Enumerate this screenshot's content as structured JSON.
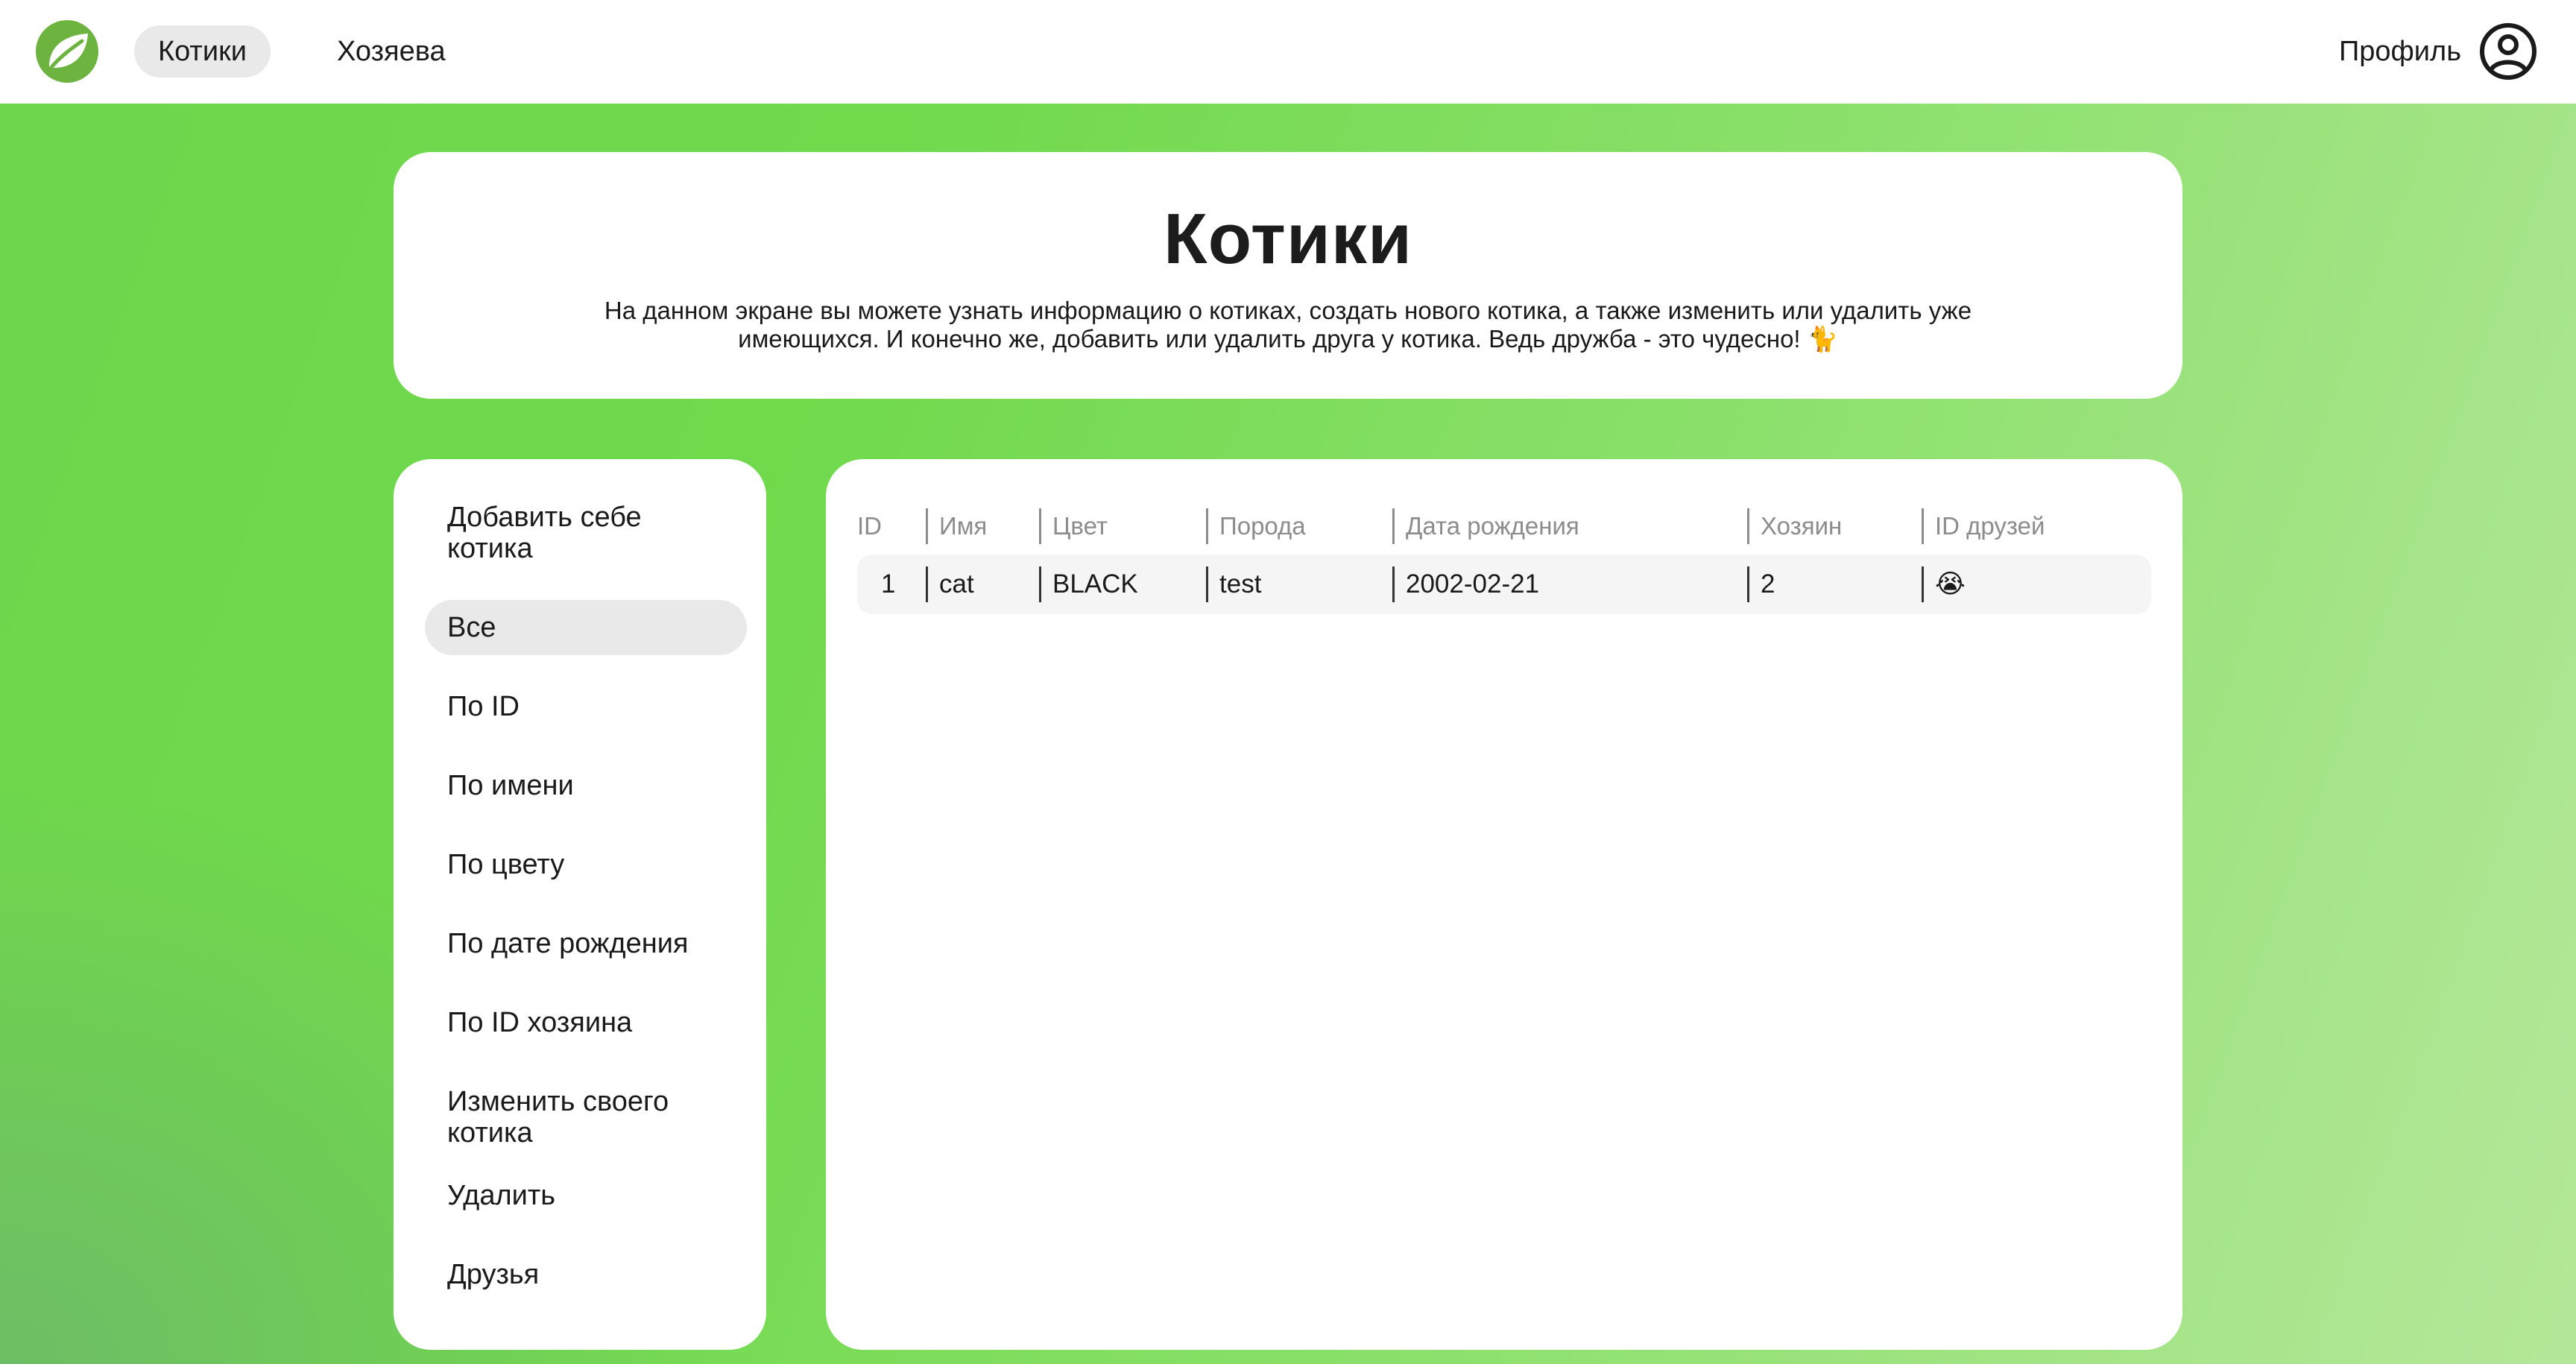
{
  "nav": {
    "tabs": [
      {
        "label": "Котики",
        "active": true
      },
      {
        "label": "Хозяева",
        "active": false
      }
    ],
    "profile_label": "Профиль",
    "logo_icon": "leaf-logo-icon",
    "profile_icon": "user-circle-icon"
  },
  "header": {
    "title": "Котики",
    "description": "На данном экране вы можете узнать информацию о котиках, создать нового котика, а также изменить или удалить уже имеющихся. И конечно же, добавить или удалить друга у котика. Ведь дружба - это чудесно! 🐈"
  },
  "sidebar": {
    "items": [
      {
        "label": "Добавить себе котика"
      },
      {
        "label": "Все",
        "active": true
      },
      {
        "label": "По ID"
      },
      {
        "label": "По имени"
      },
      {
        "label": "По цвету"
      },
      {
        "label": "По дате рождения"
      },
      {
        "label": "По ID хозяина"
      },
      {
        "label": "Изменить своего котика"
      },
      {
        "label": "Удалить"
      },
      {
        "label": "Друзья"
      }
    ]
  },
  "table": {
    "columns": [
      "ID",
      "Имя",
      "Цвет",
      "Порода",
      "Дата рождения",
      "Хозяин",
      "ID друзей"
    ],
    "rows": [
      {
        "id": "1",
        "name": "cat",
        "color": "BLACK",
        "breed": "test",
        "birth_date": "2002-02-21",
        "owner": "2",
        "friends": "😭"
      }
    ]
  },
  "colors": {
    "brand_green": "#6DB33F",
    "background_green": "#70d94c",
    "active_pill": "#e9e9e9"
  }
}
